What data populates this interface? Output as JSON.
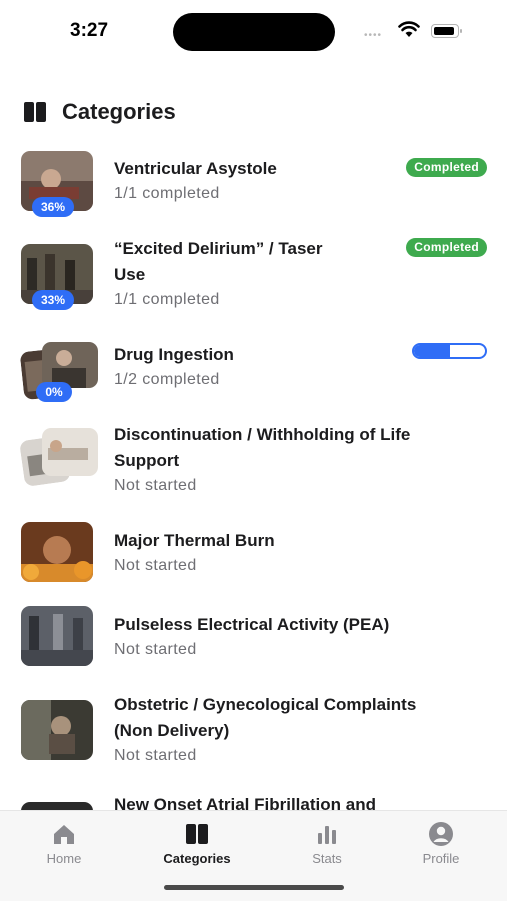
{
  "status_bar": {
    "time": "3:27",
    "signal": "••••"
  },
  "header": {
    "title": "Categories",
    "icon": "book-icon"
  },
  "categories": [
    {
      "title": "Ventricular Asystole",
      "progress_text": "1/1 completed",
      "percent": "36%",
      "status": "Completed"
    },
    {
      "title": "“Excited Delirium” / Taser Use",
      "title_line1": "“Excited Delirium” / Taser",
      "title_line2": "Use",
      "progress_text": "1/1 completed",
      "percent": "33%",
      "status": "Completed"
    },
    {
      "title": "Drug Ingestion",
      "progress_text": "1/2 completed",
      "percent": "0%",
      "progress": 0.5
    },
    {
      "title": "Discontinuation / Withholding of Life Support",
      "title_line1": "Discontinuation / Withholding of Life",
      "title_line2": "Support",
      "progress_text": "Not started"
    },
    {
      "title": "Major Thermal Burn",
      "progress_text": "Not started"
    },
    {
      "title": "Pulseless Electrical Activity (PEA)",
      "progress_text": "Not started"
    },
    {
      "title": "Obstetric / Gynecological Complaints (Non Delivery)",
      "title_line1": "Obstetric / Gynecological Complaints",
      "title_line2": "(Non Delivery)",
      "progress_text": "Not started"
    },
    {
      "title": "New Onset Atrial Fibrillation and"
    }
  ],
  "tab_bar": {
    "tabs": [
      {
        "label": "Home",
        "icon": "house-icon"
      },
      {
        "label": "Categories",
        "icon": "book-icon",
        "active": true
      },
      {
        "label": "Stats",
        "icon": "bar-chart-icon"
      },
      {
        "label": "Profile",
        "icon": "person-circle-icon"
      }
    ]
  },
  "colors": {
    "accent": "#2f6df6",
    "completed": "#3eaa4e",
    "subtext": "#6e6e73"
  }
}
